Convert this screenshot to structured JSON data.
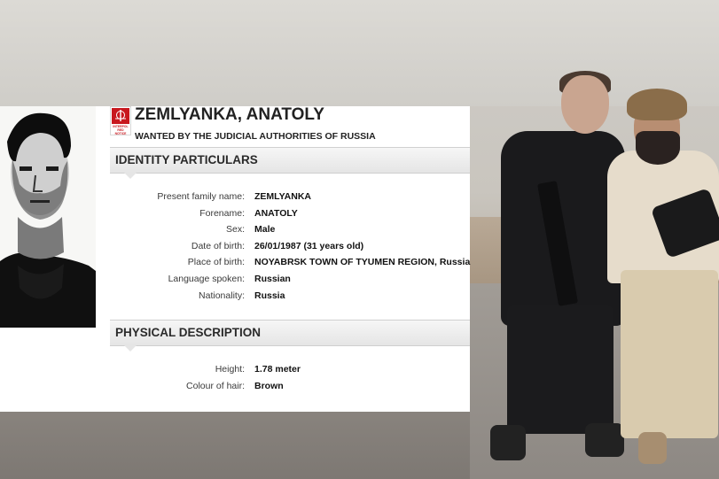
{
  "notice": {
    "name": "ZEMLYANKA, ANATOLY",
    "subtitle": "WANTED BY THE JUDICIAL AUTHORITIES OF RUSSIA",
    "logo_text": "INTERPOL RED NOTICE"
  },
  "identity": {
    "section_title": "IDENTITY PARTICULARS",
    "rows": [
      {
        "label": "Present family name:",
        "value": "ZEMLYANKA"
      },
      {
        "label": "Forename:",
        "value": "ANATOLY"
      },
      {
        "label": "Sex:",
        "value": "Male"
      },
      {
        "label": "Date of birth:",
        "value": "26/01/1987 (31 years old)"
      },
      {
        "label": "Place of birth:",
        "value": "NOYABRSK TOWN OF TYUMEN REGION, Russia"
      },
      {
        "label": "Language spoken:",
        "value": "Russian"
      },
      {
        "label": "Nationality:",
        "value": "Russia"
      }
    ]
  },
  "physical": {
    "section_title": "PHYSICAL DESCRIPTION",
    "rows": [
      {
        "label": "Height:",
        "value": "1.78 meter"
      },
      {
        "label": "Colour of hair:",
        "value": "Brown"
      }
    ]
  },
  "colors": {
    "logo_red": "#c8181e",
    "section_bar": "#e5e5e5"
  }
}
